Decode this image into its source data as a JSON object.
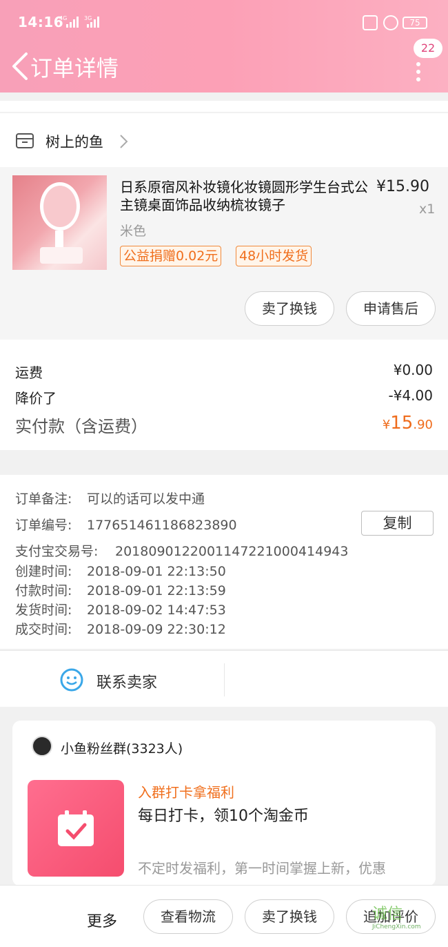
{
  "status_bar": {
    "time": "14:16",
    "network_1": "4G",
    "network_2": "3G",
    "battery": "75"
  },
  "nav": {
    "title": "订单详情",
    "badge": "22"
  },
  "shop": {
    "name": "树上的鱼"
  },
  "item": {
    "title": "日系原宿风补妆镜化妆镜圆形学生台式公主镜桌面饰品收纳梳妆镜子",
    "price": "¥15.90",
    "quantity": "x1",
    "spec": "米色",
    "tags": [
      "公益捐赠0.02元",
      "48小时发货"
    ],
    "actions": [
      "卖了换钱",
      "申请售后"
    ]
  },
  "fees": {
    "shipping_label": "运费",
    "shipping_value": "¥0.00",
    "discount_label": "降价了",
    "discount_value": "-¥4.00",
    "total_label": "实付款（含运费）",
    "total_currency": "¥",
    "total_int": "15",
    "total_dec": ".90"
  },
  "order_info": {
    "note_label": "订单备注:",
    "note_value": "可以的话可以发中通",
    "number_label": "订单编号:",
    "number_value": "177651461186823890",
    "copy_label": "复制",
    "alipay_label": "支付宝交易号:",
    "alipay_value": "2018090122001147221000414943",
    "created_label": "创建时间:",
    "created_value": "2018-09-01 22:13:50",
    "paid_label": "付款时间:",
    "paid_value": "2018-09-01 22:13:59",
    "shipped_label": "发货时间:",
    "shipped_value": "2018-09-02 14:47:53",
    "completed_label": "成交时间:",
    "completed_value": "2018-09-09 22:30:12"
  },
  "contact": {
    "label": "联系卖家"
  },
  "group": {
    "name": "小鱼粉丝群(3323人)",
    "promo_title": "入群打卡拿福利",
    "promo_main": "每日打卡，领10个淘金币",
    "promo_desc": "不定时发福利，第一时间掌握上新，优惠"
  },
  "bottom_bar": {
    "more": "更多",
    "buttons": [
      "查看物流",
      "卖了换钱",
      "追加评价"
    ]
  },
  "watermark": {
    "text": "诚信",
    "sub": "JiChengXin.com"
  },
  "colors": {
    "header_pink": "#fca0b6",
    "accent_orange": "#f06f1d",
    "badge_text": "#e0457b"
  }
}
